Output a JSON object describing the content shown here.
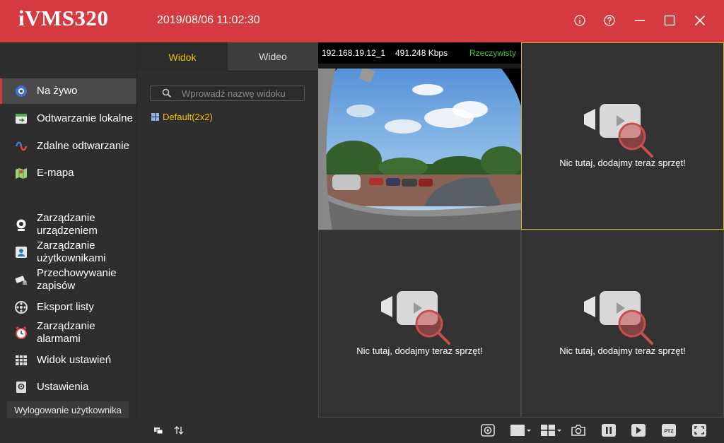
{
  "app": {
    "logo": "iVMS320",
    "datetime": "2019/08/06 11:02:30"
  },
  "sidebar": {
    "items": [
      {
        "label": "Na żywo",
        "icon": "live-view-icon",
        "active": true
      },
      {
        "label": "Odtwarzanie lokalne",
        "icon": "local-playback-icon"
      },
      {
        "label": "Zdalne odtwarzanie",
        "icon": "remote-playback-icon"
      },
      {
        "label": "E-mapa",
        "icon": "emap-icon"
      },
      {
        "label": "Zarządzanie urządzeniem",
        "icon": "device-management-icon"
      },
      {
        "label": "Zarządzanie użytkownikami",
        "icon": "user-management-icon"
      },
      {
        "label": "Przechowywanie zapisów",
        "icon": "storage-icon"
      },
      {
        "label": "Eksport listy",
        "icon": "export-list-icon"
      },
      {
        "label": "Zarządzanie alarmami",
        "icon": "alarm-icon"
      },
      {
        "label": "Widok ustawień",
        "icon": "settings-view-icon"
      },
      {
        "label": "Ustawienia",
        "icon": "settings-icon"
      }
    ],
    "logout": "Wylogowanie użytkownika"
  },
  "panel": {
    "tabs": [
      "Widok",
      "Wideo"
    ],
    "search_placeholder": "Wprowadź nazwę widoku",
    "views": [
      "Default(2x2)"
    ]
  },
  "grid": {
    "live": {
      "ip": "192.168.19.12_1",
      "bitrate": "491.248 Kbps",
      "mode": "Rzeczywisty"
    },
    "empty_message": "Nic tutaj, dodajmy teraz sprzęt!"
  },
  "colors": {
    "accent": "#d43a3f",
    "highlight": "#f2c200",
    "live_mode": "#3ec43e"
  }
}
